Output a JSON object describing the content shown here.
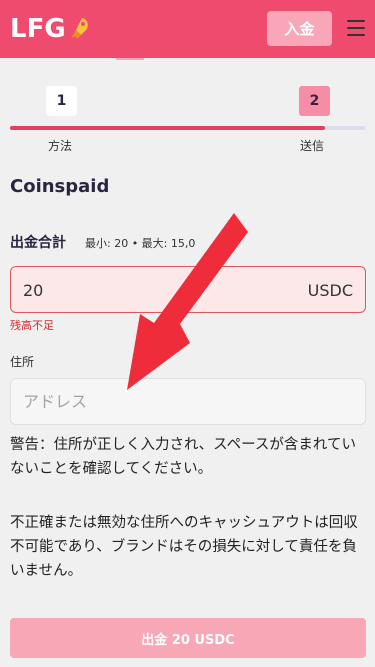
{
  "header": {
    "logo_text": "LFG",
    "logo_icon": "rocket-icon",
    "deposit_label": "入金",
    "menu_icon": "hamburger-menu-icon"
  },
  "stepper": {
    "steps": [
      {
        "number": "1",
        "label": "方法"
      },
      {
        "number": "2",
        "label": "送信"
      }
    ],
    "progress_fraction": 0.885,
    "accent_color": "#e0405e"
  },
  "title": "Coinspaid",
  "amount": {
    "label": "出金合計",
    "limits": "最小: 20 • 最大: 15,0",
    "value": "20",
    "currency": "USDC",
    "error": "残高不足"
  },
  "address": {
    "label": "住所",
    "placeholder": "アドレス"
  },
  "warnings": {
    "warning_1": "警告：住所が正しく入力され、スペースが含まれていないことを確認してください。",
    "warning_2": "不正確または無効な住所へのキャッシュアウトは回収不可能であり、ブランドはその損失に対して責任を負いません。"
  },
  "submit": {
    "label": "出金 20 USDC"
  },
  "annotation": {
    "arrow_icon": "arrow-annotation",
    "arrow_color": "#ef2d3a"
  },
  "colors": {
    "brand": "#ef4b6e",
    "button_disabled": "#f8a7b7",
    "error": "#d12c2c"
  }
}
